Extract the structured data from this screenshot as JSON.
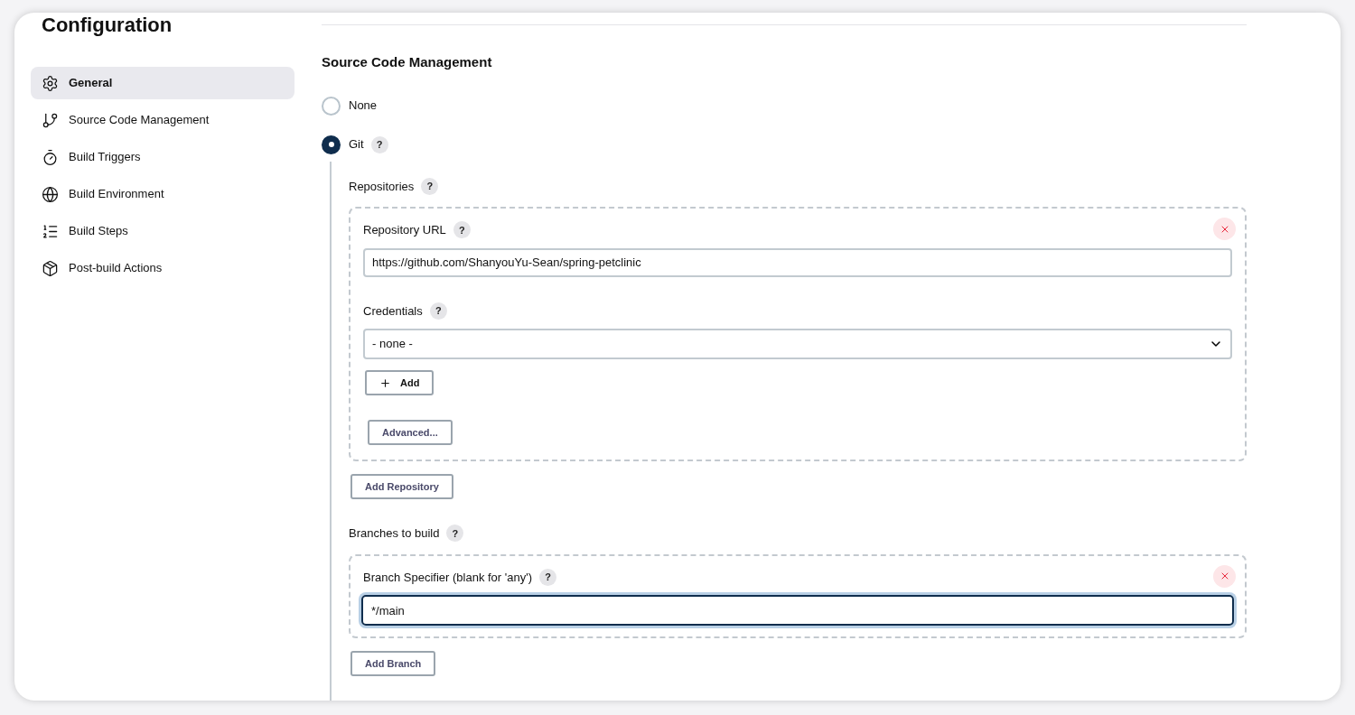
{
  "title": "Configuration",
  "sidebar": {
    "items": [
      {
        "label": "General",
        "selected": true
      },
      {
        "label": "Source Code Management",
        "selected": false
      },
      {
        "label": "Build Triggers",
        "selected": false
      },
      {
        "label": "Build Environment",
        "selected": false
      },
      {
        "label": "Build Steps",
        "selected": false
      },
      {
        "label": "Post-build Actions",
        "selected": false
      }
    ]
  },
  "section": {
    "title": "Source Code Management",
    "options": [
      {
        "label": "None",
        "selected": false
      },
      {
        "label": "Git",
        "selected": true,
        "help": "?"
      }
    ],
    "repositories": {
      "label": "Repositories",
      "help": "?",
      "items": [
        {
          "url_label": "Repository URL",
          "url_help": "?",
          "url": "https://github.com/ShanyouYu-Sean/spring-petclinic",
          "credentials_label": "Credentials",
          "credentials_help": "?",
          "credentials": "- none -",
          "add_button": "Add",
          "advanced_button": "Advanced..."
        }
      ],
      "add_button": "Add Repository"
    },
    "branches": {
      "label": "Branches to build",
      "help": "?",
      "items": [
        {
          "label": "Branch Specifier (blank for 'any')",
          "help": "?",
          "value": "*/main",
          "focused": true
        }
      ],
      "add_button": "Add Branch"
    }
  }
}
